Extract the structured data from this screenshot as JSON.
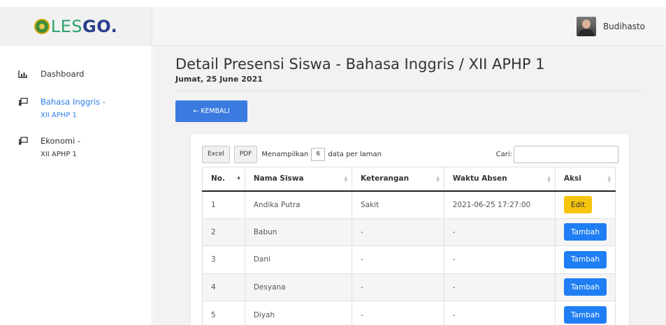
{
  "brand": {
    "logo_prefix": "LES",
    "logo_suffix": "GO."
  },
  "user": {
    "name": "Budihasto"
  },
  "sidebar": {
    "items": [
      {
        "label": "Dashboard",
        "sub": ""
      },
      {
        "label": "Bahasa Inggris -",
        "sub": "XII APHP 1"
      },
      {
        "label": "Ekonomi -",
        "sub": "XII APHP 1"
      }
    ]
  },
  "page": {
    "title": "Detail Presensi Siswa - Bahasa Inggris / XII APHP 1",
    "date": "Jumat, 25 June 2021",
    "back_label": "← KEMBALI"
  },
  "table_controls": {
    "excel_label": "Excel",
    "pdf_label": "PDF",
    "length_prefix": "Menampilkan",
    "length_value": "6",
    "length_suffix": "data per laman",
    "search_label": "Cari:"
  },
  "table": {
    "headers": [
      "No.",
      "Nama Siswa",
      "Keterangan",
      "Waktu Absen",
      "Aksi"
    ],
    "rows": [
      {
        "no": "1",
        "nama": "Andika Putra",
        "ket": "Sakit",
        "waktu": "2021-06-25 17:27:00",
        "aksi": "Edit"
      },
      {
        "no": "2",
        "nama": "Babun",
        "ket": "-",
        "waktu": "-",
        "aksi": "Tambah"
      },
      {
        "no": "3",
        "nama": "Dani",
        "ket": "-",
        "waktu": "-",
        "aksi": "Tambah"
      },
      {
        "no": "4",
        "nama": "Desyana",
        "ket": "-",
        "waktu": "-",
        "aksi": "Tambah"
      },
      {
        "no": "5",
        "nama": "Diyah",
        "ket": "-",
        "waktu": "-",
        "aksi": "Tambah"
      }
    ]
  },
  "colors": {
    "accent": "#3b7be0",
    "edit": "#f7c510",
    "add": "#1f7ef3",
    "active_link": "#2f7ce8"
  },
  "icons": [
    "logo-icon",
    "chart-icon",
    "chalkboard-icon",
    "chalkboard-icon",
    "sort-icon"
  ]
}
